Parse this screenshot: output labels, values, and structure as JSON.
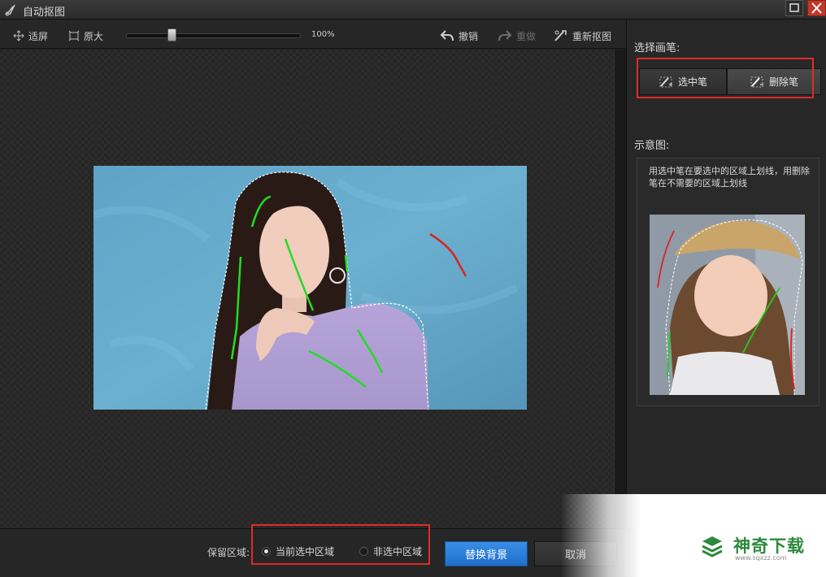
{
  "window": {
    "title": "自动抠图"
  },
  "toolbar": {
    "fit_label": "适屏",
    "actual_label": "原大",
    "zoom_text": "100%",
    "zoom_percent": 100,
    "undo_label": "撤销",
    "redo_label": "重做",
    "redo_enabled": false,
    "restart_label": "重新抠图"
  },
  "right_panel": {
    "brush_title": "选择画笔:",
    "select_brush_label": "选中笔",
    "delete_brush_label": "删除笔",
    "active_brush": "delete",
    "demo_title": "示意图:",
    "demo_desc": "用选中笔在要选中的区域上划线，用删除笔在不需要的区域上划线"
  },
  "bottom": {
    "keep_label": "保留区域:",
    "option_current": "当前选中区域",
    "option_unselected": "非选中区域",
    "selected_option": "current",
    "replace_button": "替换背景",
    "cancel_button": "取消"
  },
  "watermark": {
    "brand": "神奇下载",
    "url": "www.sqxzz.com"
  },
  "colors": {
    "highlight_box": "#e02b2b",
    "primary_button": "#2a7ed8",
    "select_stroke": "#22dd22",
    "delete_stroke": "#dd2222",
    "brand_green": "#2c8a3c"
  },
  "icons": [
    "scissors-icon",
    "maximize-icon",
    "close-icon",
    "fit-screen-icon",
    "actual-size-icon",
    "undo-icon",
    "redo-icon",
    "restart-cutout-icon",
    "select-brush-icon",
    "delete-brush-icon",
    "brand-logo-icon"
  ]
}
